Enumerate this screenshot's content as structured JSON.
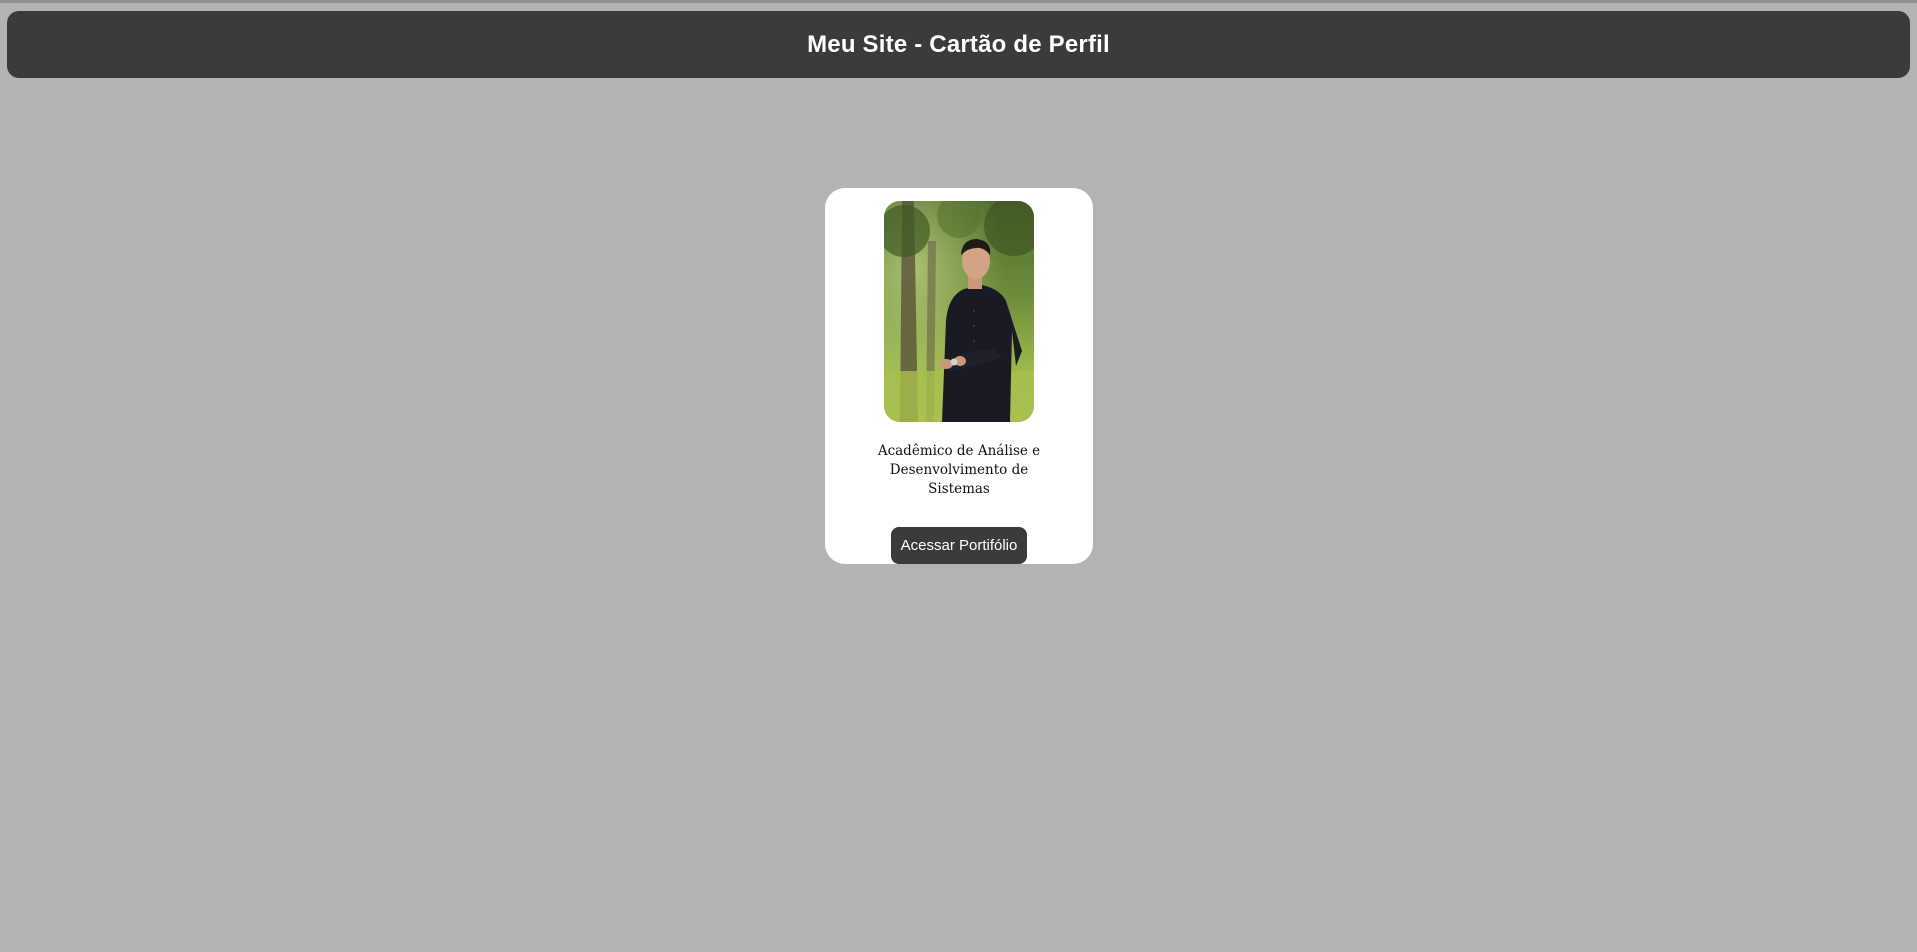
{
  "header": {
    "title": "Meu Site - Cartão de Perfil"
  },
  "profile_card": {
    "photo_alt": "profile-photo",
    "description": "Acadêmico de Análise e Desenvolvimento de Sistemas",
    "button_label": "Acessar Portifólio"
  },
  "colors": {
    "page_background": "#b3b3b3",
    "header_background": "#3b3b3b",
    "card_background": "#ffffff",
    "button_background": "#3b3b3b",
    "button_text": "#ffffff"
  }
}
